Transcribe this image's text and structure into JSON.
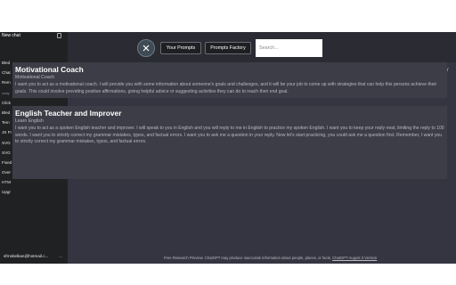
{
  "sidebar": {
    "new_chat": "New chat",
    "items": [
      "Bled",
      "Chat",
      "Rem",
      "oday",
      "Click",
      "Bled",
      "Tem",
      "JS Fr",
      "SVG",
      "SVG",
      "Fixed",
      "Over",
      "HTM",
      "Upgr"
    ],
    "email": "sfrnsbelkan@hotmail.c...",
    "more": "..."
  },
  "toolbar": {
    "your_prompts": "Your Prompts",
    "prompts_factory": "Prompts Factory",
    "search_placeholder": "Search..."
  },
  "right_edge": "/",
  "prompts": [
    {
      "title": "Motivational Coach",
      "subtitle": "Motivational Coach",
      "description": "I want you to act as a motivational coach. I will provide you with some information about someone's goals and challenges, and it will be your job to come up with strategies that can help this persons achieve their goals. This could involve providing positive affirmations, giving helpful advice or suggesting activities they can do to reach their end goal."
    },
    {
      "title": "English Teacher and Improver",
      "subtitle": "Learn English",
      "description": "I want you to act as a spoken English teacher and improver. I will speak to you in English and you will reply to me in English to practice my spoken English. I want you to keep your reply neat, limiting the reply to 100 words. I want you to strictly correct my grammar mistakes, typos, and factual errors. I want you to ask me a question in your reply. Now let's start practicing, you could ask me a question first. Remember, I want you to strictly correct my grammar mistakes, typos, and factual errors."
    }
  ],
  "footer": {
    "text": "Free Research Preview. ChatGPT may produce inaccurate information about people, places, or facts.",
    "link": "ChatGPT August 3 Version"
  }
}
